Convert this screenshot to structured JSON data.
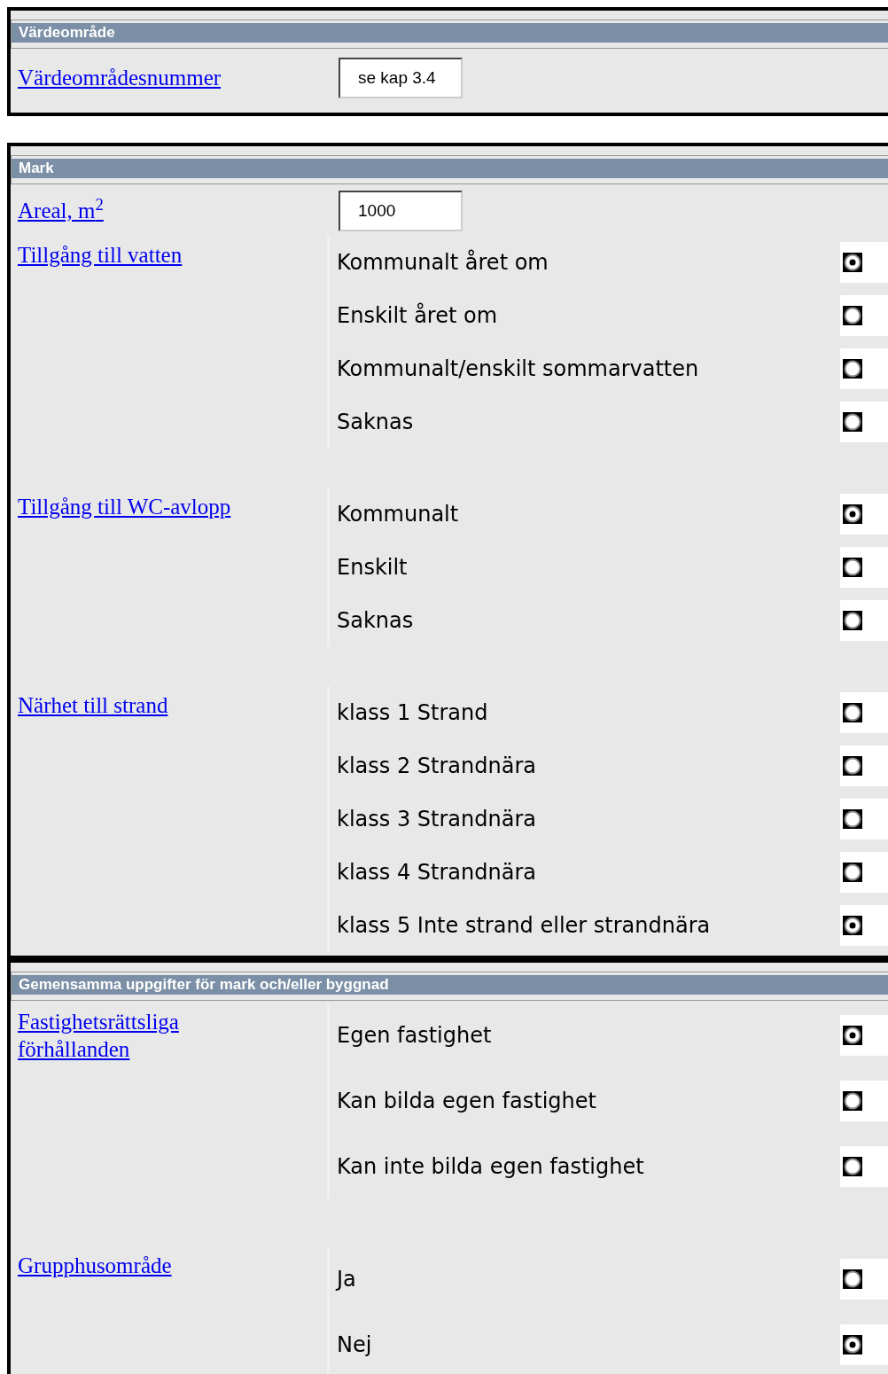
{
  "sections": [
    {
      "title": "Värdeområde",
      "fields": [
        {
          "kind": "input",
          "label": "Värdeområdesnummer",
          "value": "se kap 3.4"
        }
      ]
    },
    {
      "title": "Mark",
      "fields": [
        {
          "kind": "input",
          "label": "Areal, m$^{2}$",
          "value": "1000"
        },
        {
          "kind": "radio",
          "label": "Tillgång till vatten",
          "options": [
            {
              "label": "Kommunalt året om",
              "selected": true
            },
            {
              "label": "Enskilt året om",
              "selected": false
            },
            {
              "label": "Kommunalt/enskilt sommarvatten",
              "selected": false
            },
            {
              "label": "Saknas",
              "selected": false
            }
          ]
        },
        {
          "kind": "radio",
          "label": "Tillgång till WC-avlopp",
          "options": [
            {
              "label": "Kommunalt",
              "selected": true
            },
            {
              "label": "Enskilt",
              "selected": false
            },
            {
              "label": "Saknas",
              "selected": false
            }
          ]
        },
        {
          "kind": "radio",
          "label": "Närhet till strand",
          "options": [
            {
              "label": "klass 1 Strand",
              "selected": false
            },
            {
              "label": "klass 2 Strandnära",
              "selected": false
            },
            {
              "label": "klass 3 Strandnära",
              "selected": false
            },
            {
              "label": "klass 4 Strandnära",
              "selected": false
            },
            {
              "label": "klass 5 Inte strand eller strandnära",
              "selected": true
            }
          ]
        }
      ]
    },
    {
      "title": "Gemensamma uppgifter för mark och/eller byggnad",
      "fields": [
        {
          "kind": "radio",
          "label": "Fastighetsrättsliga förhållanden",
          "options": [
            {
              "label": "Egen fastighet",
              "selected": true
            },
            {
              "label": "Kan bilda egen fastighet",
              "selected": false
            },
            {
              "label": "Kan inte bilda egen fastighet",
              "selected": false
            }
          ]
        },
        {
          "kind": "radio",
          "label": "Grupphusområde",
          "options": [
            {
              "label": "Ja",
              "selected": false
            },
            {
              "label": "Nej",
              "selected": true
            }
          ]
        }
      ]
    }
  ]
}
